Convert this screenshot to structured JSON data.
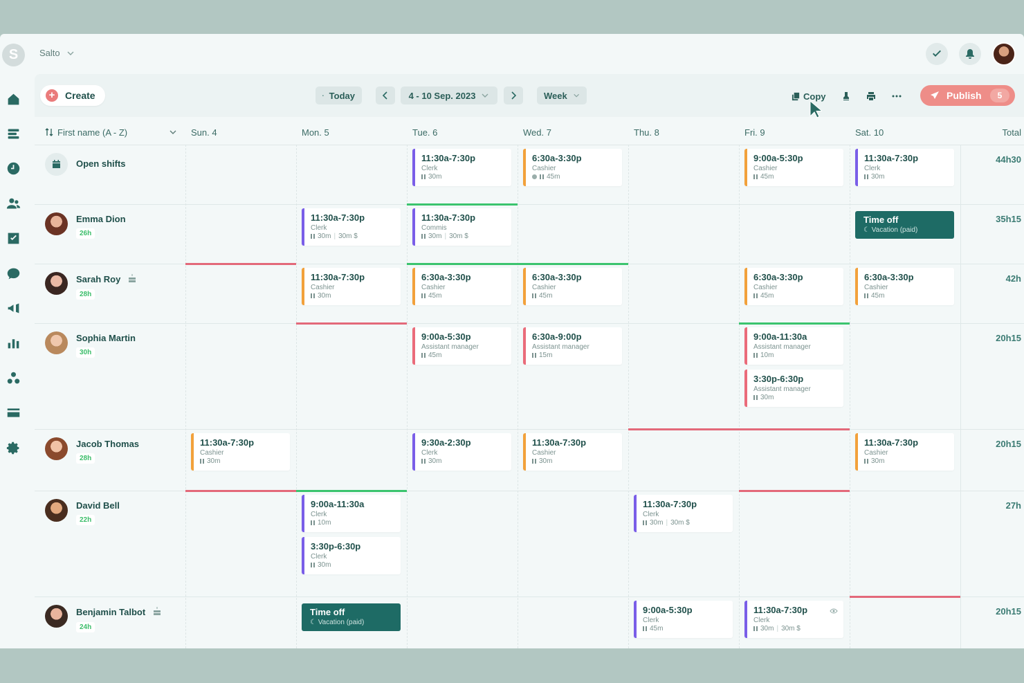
{
  "app": {
    "logo_letter": "S",
    "org_name": "Salto"
  },
  "toolbar": {
    "create_label": "Create",
    "today_label": "Today",
    "date_range": "4 - 10 Sep. 2023",
    "view_label": "Week",
    "copy_label": "Copy",
    "publish_label": "Publish",
    "publish_count": "5"
  },
  "grid": {
    "sort_label": "First name (A - Z)",
    "days": [
      "Sun. 4",
      "Mon. 5",
      "Tue. 6",
      "Wed. 7",
      "Thu. 8",
      "Fri. 9",
      "Sat. 10"
    ],
    "total_label": "Total"
  },
  "rows": [
    {
      "name": "Open shifts",
      "total": "44h30",
      "shifts": [
        {
          "day": 2,
          "time": "11:30a-7:30p",
          "role": "Clerk",
          "break": "30m",
          "color": "#7a5ee8"
        },
        {
          "day": 3,
          "time": "6:30a-3:30p",
          "role": "Cashier",
          "break": "45m",
          "color": "#f2a13b",
          "dot": true
        },
        {
          "day": 5,
          "time": "9:00a-5:30p",
          "role": "Cashier",
          "break": "45m",
          "color": "#f2a13b"
        },
        {
          "day": 6,
          "time": "11:30a-7:30p",
          "role": "Clerk",
          "break": "30m",
          "color": "#7a5ee8"
        }
      ]
    },
    {
      "name": "Emma Dion",
      "hours": "26h",
      "total": "35h15",
      "shifts": [
        {
          "day": 1,
          "time": "11:30a-7:30p",
          "role": "Clerk",
          "break": "30m",
          "extra": "30m $",
          "color": "#7a5ee8"
        },
        {
          "day": 2,
          "time": "11:30a-7:30p",
          "role": "Commis",
          "break": "30m",
          "extra": "30m $",
          "color": "#7a5ee8"
        }
      ],
      "timeoff": {
        "day": 6,
        "title": "Time off",
        "sub": "Vacation (paid)"
      }
    },
    {
      "name": "Sarah Roy",
      "hours": "28h",
      "total": "42h",
      "shifts": [
        {
          "day": 1,
          "time": "11:30a-7:30p",
          "role": "Cashier",
          "break": "30m",
          "color": "#f2a13b"
        },
        {
          "day": 2,
          "time": "6:30a-3:30p",
          "role": "Cashier",
          "break": "45m",
          "color": "#f2a13b"
        },
        {
          "day": 3,
          "time": "6:30a-3:30p",
          "role": "Cashier",
          "break": "45m",
          "color": "#f2a13b"
        },
        {
          "day": 5,
          "time": "6:30a-3:30p",
          "role": "Cashier",
          "break": "45m",
          "color": "#f2a13b"
        },
        {
          "day": 6,
          "time": "6:30a-3:30p",
          "role": "Cashier",
          "break": "45m",
          "color": "#f2a13b"
        }
      ]
    },
    {
      "name": "Sophia Martin",
      "hours": "30h",
      "total": "20h15",
      "shifts": [
        {
          "day": 2,
          "time": "9:00a-5:30p",
          "role": "Assistant manager",
          "break": "45m",
          "color": "#ea6b7a"
        },
        {
          "day": 3,
          "time": "6:30a-9:00p",
          "role": "Assistant manager",
          "break": "15m",
          "color": "#ea6b7a"
        },
        {
          "day": 5,
          "time": "9:00a-11:30a",
          "role": "Assistant manager",
          "break": "10m",
          "color": "#ea6b7a"
        },
        {
          "day": 5,
          "slot": 1,
          "time": "3:30p-6:30p",
          "role": "Assistant manager",
          "break": "30m",
          "color": "#ea6b7a"
        }
      ]
    },
    {
      "name": "Jacob Thomas",
      "hours": "28h",
      "total": "20h15",
      "shifts": [
        {
          "day": 0,
          "time": "11:30a-7:30p",
          "role": "Cashier",
          "break": "30m",
          "color": "#f2a13b"
        },
        {
          "day": 2,
          "time": "9:30a-2:30p",
          "role": "Clerk",
          "break": "30m",
          "color": "#7a5ee8"
        },
        {
          "day": 3,
          "time": "11:30a-7:30p",
          "role": "Cashier",
          "break": "30m",
          "color": "#f2a13b"
        },
        {
          "day": 6,
          "time": "11:30a-7:30p",
          "role": "Cashier",
          "break": "30m",
          "color": "#f2a13b"
        }
      ]
    },
    {
      "name": "David Bell",
      "hours": "22h",
      "total": "27h",
      "shifts": [
        {
          "day": 1,
          "time": "9:00a-11:30a",
          "role": "Clerk",
          "break": "10m",
          "color": "#7a5ee8"
        },
        {
          "day": 1,
          "slot": 1,
          "time": "3:30p-6:30p",
          "role": "Clerk",
          "break": "30m",
          "color": "#7a5ee8"
        },
        {
          "day": 4,
          "time": "11:30a-7:30p",
          "role": "Clerk",
          "break": "30m",
          "extra": "30m $",
          "color": "#7a5ee8"
        }
      ]
    },
    {
      "name": "Benjamin Talbot",
      "hours": "24h",
      "total": "20h15",
      "shifts": [
        {
          "day": 4,
          "time": "9:00a-5:30p",
          "role": "Clerk",
          "break": "45m",
          "color": "#7a5ee8"
        },
        {
          "day": 5,
          "time": "11:30a-7:30p",
          "role": "Clerk",
          "break": "30m",
          "extra": "30m $",
          "color": "#7a5ee8",
          "eye": true
        }
      ],
      "timeoff": {
        "day": 1,
        "title": "Time off",
        "sub": "Vacation (paid)"
      }
    }
  ]
}
